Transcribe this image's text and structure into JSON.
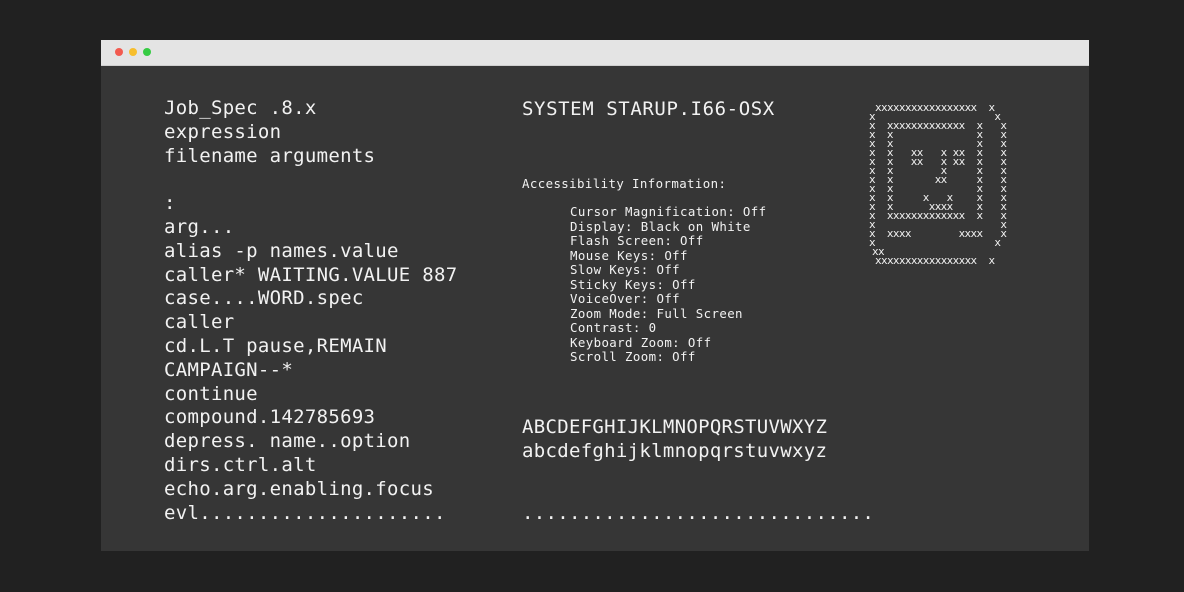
{
  "window": {
    "controls": [
      "close",
      "minimize",
      "zoom"
    ],
    "colors": {
      "close": "#f25a4f",
      "minimize": "#f7be2d",
      "zoom": "#36cb43",
      "background": "#363636",
      "titlebar": "#e4e4e4",
      "text": "#f2f2f2"
    }
  },
  "left_column": {
    "lines": [
      "Job_Spec .8.x",
      "expression",
      "filename arguments",
      "",
      ":",
      "arg...",
      "alias -p names.value",
      "caller* WAITING.VALUE 887",
      "case....WORD.spec",
      "caller",
      "cd.L.T pause,REMAIN",
      "CAMPAIGN--*",
      "continue",
      "compound.142785693",
      "depress. name..option",
      "dirs.ctrl.alt",
      "echo.arg.enabling.focus",
      "evl....................."
    ]
  },
  "middle_column": {
    "title": "SYSTEM STARUP.I66-OSX",
    "accessibility_heading": "Accessibility Information:",
    "accessibility_items": [
      "Cursor Magnification: Off",
      "Display: Black on White",
      "Flash Screen: Off",
      "Mouse Keys: Off",
      "Slow Keys: Off",
      "Sticky Keys: Off",
      "VoiceOver: Off",
      "Zoom Mode: Full Screen",
      "Contrast: 0",
      "Keyboard Zoom: Off",
      "Scroll Zoom: Off"
    ],
    "uppercase": "ABCDEFGHIJKLMNOPQRSTUVWXYZ",
    "lowercase": "abcdefghijklmnopqrstuvwxyz",
    "dots": ".............................."
  },
  "ascii_art": {
    "icon": "mac-face-icon",
    "glyph": "x"
  }
}
